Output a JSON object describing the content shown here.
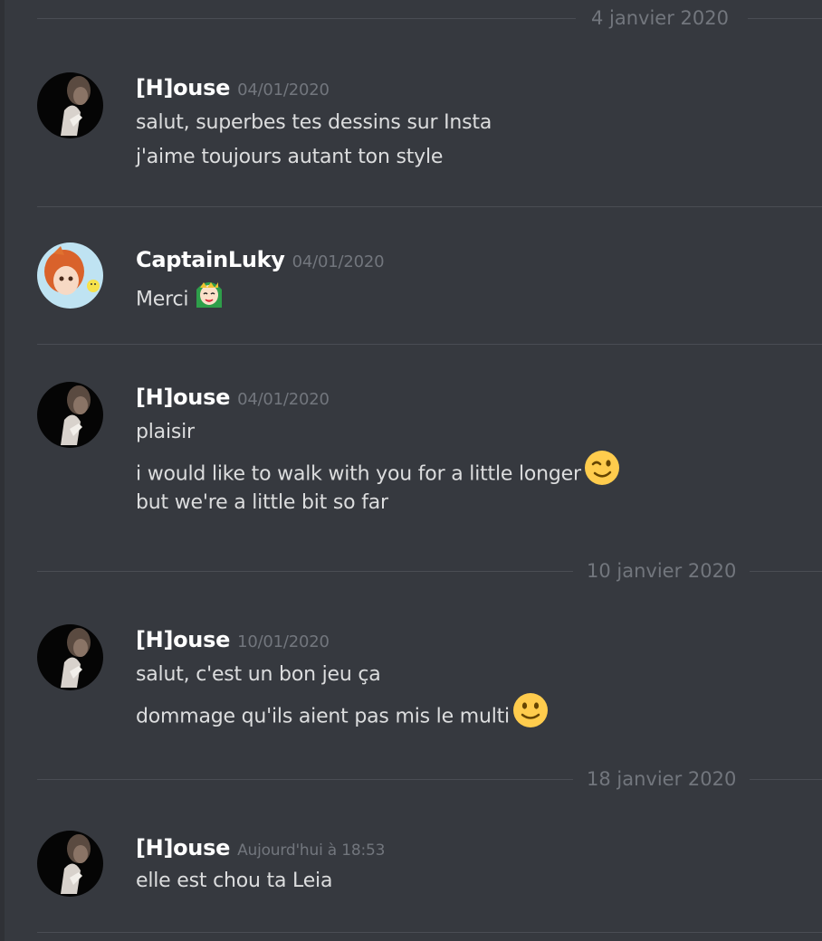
{
  "dividers": [
    {
      "label": "4 janvier 2020"
    },
    {
      "label": "10 janvier 2020"
    },
    {
      "label": "18 janvier 2020"
    }
  ],
  "messages": [
    {
      "username": "[H]ouse",
      "timestamp": "04/01/2020",
      "avatar_icon": "house-avatar-icon",
      "lines": [
        "salut, superbes tes dessins sur Insta",
        "j'aime toujours autant ton style"
      ]
    },
    {
      "username": "CaptainLuky",
      "timestamp": "04/01/2020",
      "avatar_icon": "captainluky-avatar-icon",
      "lines": [
        "Merci"
      ],
      "emoji": "anime-girl-emote-icon"
    },
    {
      "username": "[H]ouse",
      "timestamp": "04/01/2020",
      "avatar_icon": "house-avatar-icon",
      "lines": [
        "plaisir",
        "i would like to walk with you for a little longer",
        "but we're a little bit so far"
      ],
      "emoji": "winking-face-emoji-icon"
    },
    {
      "username": "[H]ouse",
      "timestamp": "10/01/2020",
      "avatar_icon": "house-avatar-icon",
      "lines": [
        "salut, c'est un bon jeu ça",
        "dommage qu'ils aient pas mis le multi"
      ],
      "emoji": "slightly-smiling-face-emoji-icon"
    },
    {
      "username": "[H]ouse",
      "timestamp": "Aujourd'hui à 18:53",
      "avatar_icon": "house-avatar-icon",
      "lines": [
        "elle est chou ta Leia"
      ]
    }
  ],
  "colors": {
    "background": "#36393f",
    "username": "#ffffff",
    "message_text": "#dcddde",
    "timestamp": "#72767d",
    "divider": "#4a4d54",
    "emoji_yellow": "#ffcc4d"
  }
}
